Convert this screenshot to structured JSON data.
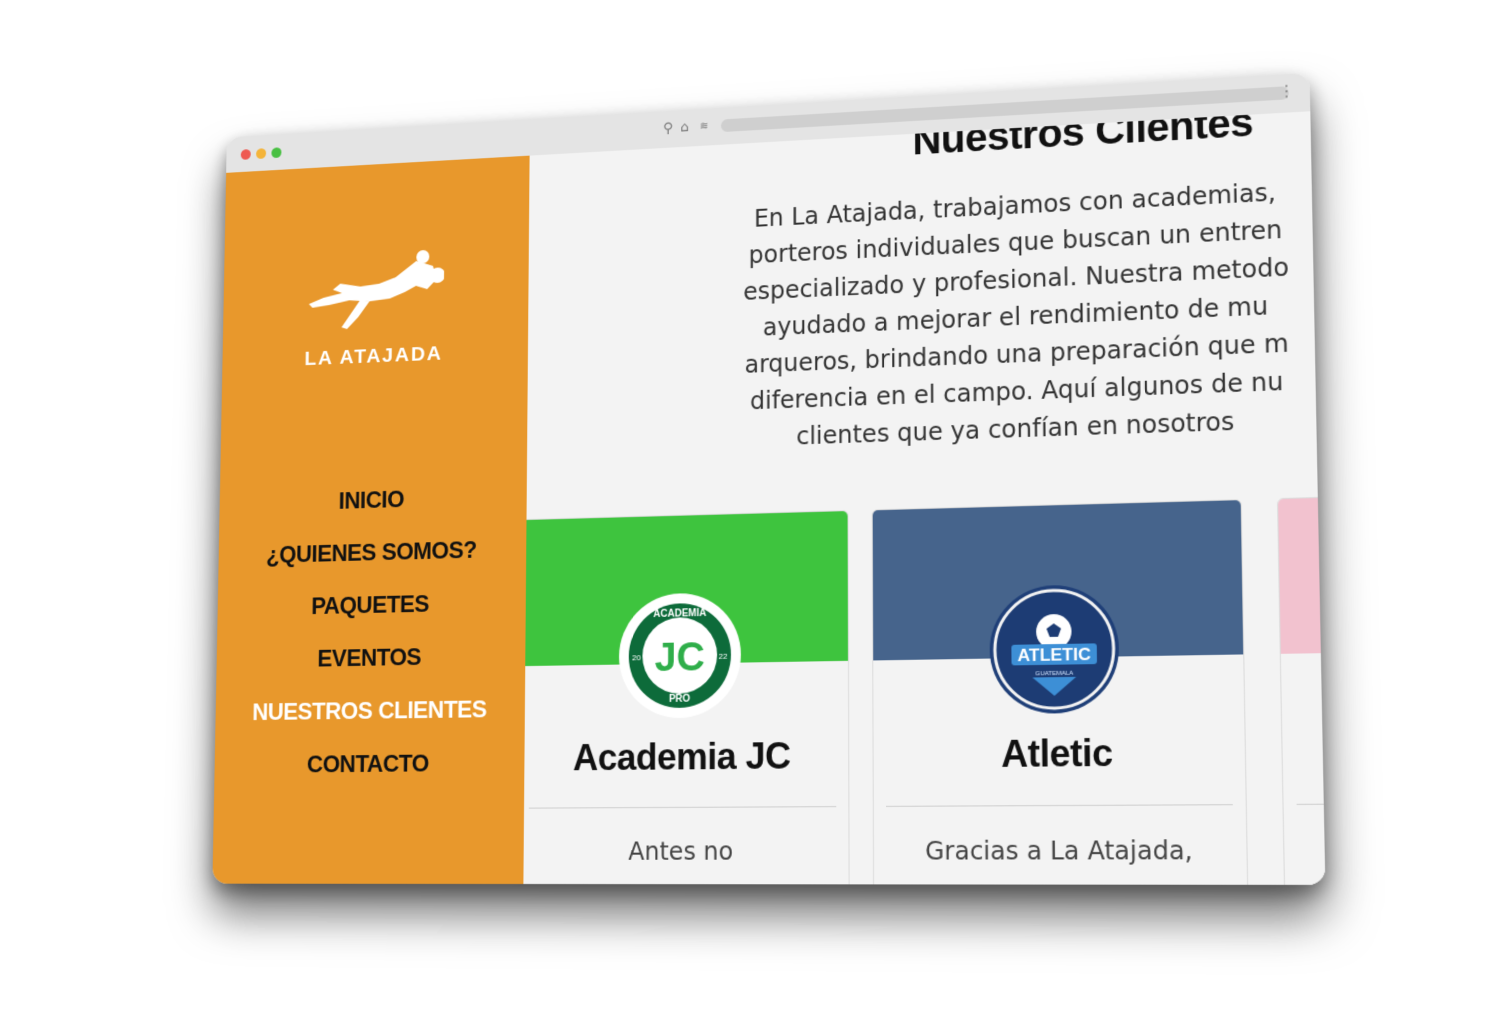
{
  "brand": {
    "name": "LA ATAJADA",
    "logo_icon": "goalkeeper-diving-icon",
    "sidebar_color": "#e8982c"
  },
  "nav": {
    "items": [
      {
        "label": "INICIO",
        "active": false
      },
      {
        "label": "¿QUIENES SOMOS?",
        "active": false
      },
      {
        "label": "PAQUETES",
        "active": false
      },
      {
        "label": "EVENTOS",
        "active": false
      },
      {
        "label": "NUESTROS CLIENTES",
        "active": true
      },
      {
        "label": "CONTACTO",
        "active": false
      }
    ]
  },
  "section": {
    "title": "Nuestros Clientes",
    "intro_lines": [
      "En La Atajada, trabajamos con academias,",
      "porteros individuales que buscan un entren",
      "especializado y profesional. Nuestra metodo",
      "ayudado a mejorar el rendimiento de mu",
      "arqueros, brindando una preparación que m",
      "diferencia en el campo. Aquí algunos de nu",
      "clientes que ya confían en nosotros"
    ]
  },
  "clients": [
    {
      "name": "Academia JC",
      "banner_color": "#3ec43e",
      "logo": {
        "top": "ACADEMIA",
        "center": "JC",
        "bottom": "PRO",
        "year_left": "20",
        "year_right": "22"
      },
      "testimonial": "Antes no"
    },
    {
      "name": "Atletic",
      "banner_color": "#46648c",
      "logo": {
        "center": "ATLETIC",
        "sub": "GUATEMALA"
      },
      "testimonial": "Gracias a La Atajada,"
    },
    {
      "name": "",
      "banner_color": "#f2c2cf",
      "testimonial": ""
    }
  ]
}
